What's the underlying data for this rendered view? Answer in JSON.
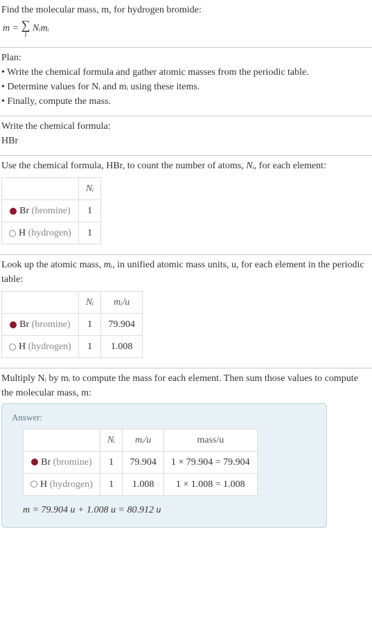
{
  "intro": {
    "line1": "Find the molecular mass, m, for hydrogen bromide:",
    "formula_m": "m",
    "formula_eq": " = ",
    "formula_sigma": "∑",
    "formula_idx": "i",
    "formula_rhs": " Nᵢmᵢ"
  },
  "plan": {
    "heading": "Plan:",
    "b1": "• Write the chemical formula and gather atomic masses from the periodic table.",
    "b2": "• Determine values for Nᵢ and mᵢ using these items.",
    "b3": "• Finally, compute the mass."
  },
  "step1": {
    "heading": "Write the chemical formula:",
    "formula": "HBr"
  },
  "step2": {
    "heading_a": "Use the chemical formula, HBr, to count the number of atoms, ",
    "heading_ni": "Nᵢ",
    "heading_b": ", for each element:",
    "col_ni": "Nᵢ",
    "rows": [
      {
        "sym": "Br",
        "name": "(bromine)",
        "ni": "1"
      },
      {
        "sym": "H",
        "name": "(hydrogen)",
        "ni": "1"
      }
    ]
  },
  "step3": {
    "heading_a": "Look up the atomic mass, ",
    "heading_mi": "mᵢ",
    "heading_b": ", in unified atomic mass units, u, for each element in the periodic table:",
    "col_ni": "Nᵢ",
    "col_mi": "mᵢ/u",
    "rows": [
      {
        "sym": "Br",
        "name": "(bromine)",
        "ni": "1",
        "mi": "79.904"
      },
      {
        "sym": "H",
        "name": "(hydrogen)",
        "ni": "1",
        "mi": "1.008"
      }
    ]
  },
  "step4": {
    "heading": "Multiply Nᵢ by mᵢ to compute the mass for each element. Then sum those values to compute the molecular mass, m:",
    "answer_label": "Answer:",
    "col_ni": "Nᵢ",
    "col_mi": "mᵢ/u",
    "col_mass": "mass/u",
    "rows": [
      {
        "sym": "Br",
        "name": "(bromine)",
        "ni": "1",
        "mi": "79.904",
        "mass": "1 × 79.904 = 79.904"
      },
      {
        "sym": "H",
        "name": "(hydrogen)",
        "ni": "1",
        "mi": "1.008",
        "mass": "1 × 1.008 = 1.008"
      }
    ],
    "final": "m = 79.904 u + 1.008 u = 80.912 u"
  }
}
